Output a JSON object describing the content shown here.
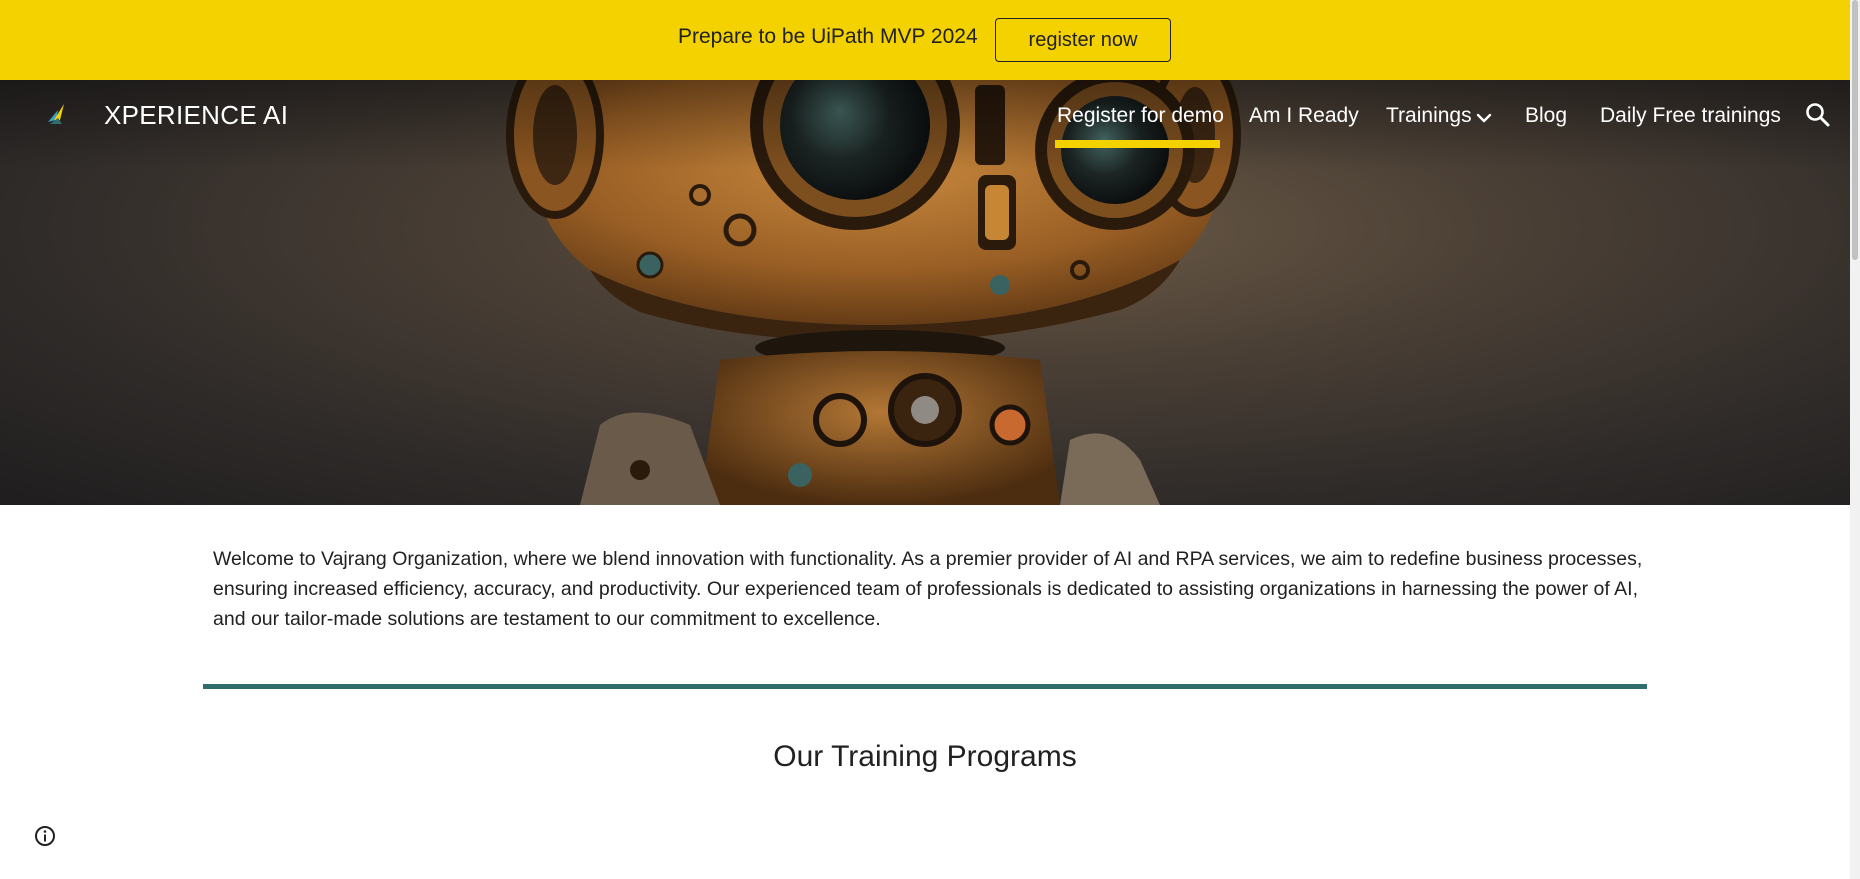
{
  "announcement": {
    "text": "Prepare to be UiPath MVP 2024",
    "button_label": "register now",
    "background_color": "#f4d200"
  },
  "header": {
    "brand_name": "XPERIENCE AI",
    "logo_icon": "brand-logo-icon",
    "nav": [
      {
        "label": "Register for demo",
        "active": true
      },
      {
        "label": "Am I Ready",
        "active": false
      },
      {
        "label": "Trainings",
        "active": false,
        "has_dropdown": true
      },
      {
        "label": "Blog",
        "active": false
      },
      {
        "label": "Daily Free trainings",
        "active": false
      }
    ],
    "search_icon": "search-icon",
    "active_underline_color": "#f4d200"
  },
  "hero": {
    "image": "robot-illustration"
  },
  "main": {
    "intro_text": "Welcome to Vajrang Organization, where we blend innovation with functionality. As a premier provider of AI and RPA services, we aim to redefine business processes, ensuring increased efficiency, accuracy, and productivity. Our experienced team of professionals is dedicated to assisting organizations in harnessing the power of AI, and our tailor-made solutions are testament to our commitment to excellence.",
    "divider_color": "#2f6e6c",
    "section_title": "Our Training Programs"
  },
  "footer": {
    "info_icon": "info-icon"
  }
}
